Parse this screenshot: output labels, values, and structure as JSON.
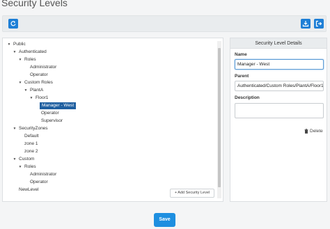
{
  "page": {
    "title": "Security Levels"
  },
  "toolbar": {
    "refresh_icon": "refresh-icon",
    "export_icon": "download-icon",
    "logout_icon": "logout-icon",
    "accent": "#1e7fd6"
  },
  "tree": {
    "nodes": [
      {
        "label": "Public",
        "toggle": "▼",
        "level": 0
      },
      {
        "label": "Authenticated",
        "toggle": "▼",
        "level": 1
      },
      {
        "label": "Roles",
        "toggle": "▼",
        "level": 2
      },
      {
        "label": "Administrator",
        "toggle": "",
        "level": 3
      },
      {
        "label": "Operator",
        "toggle": "",
        "level": 3
      },
      {
        "label": "Custom Roles",
        "toggle": "▼",
        "level": 2
      },
      {
        "label": "PlantA",
        "toggle": "▼",
        "level": 3
      },
      {
        "label": "Floor1",
        "toggle": "▼",
        "level": 4
      },
      {
        "label": "Manager - West",
        "toggle": "",
        "level": 5,
        "selected": true
      },
      {
        "label": "Operator",
        "toggle": "",
        "level": 5
      },
      {
        "label": "Supervisor",
        "toggle": "",
        "level": 5
      },
      {
        "label": "SecurityZones",
        "toggle": "▼",
        "level": 1
      },
      {
        "label": "Default",
        "toggle": "",
        "level": 2
      },
      {
        "label": "zone 1",
        "toggle": "",
        "level": 2
      },
      {
        "label": "zone 2",
        "toggle": "",
        "level": 2
      },
      {
        "label": "Custom",
        "toggle": "▼",
        "level": 1
      },
      {
        "label": "Roles",
        "toggle": "▼",
        "level": 2
      },
      {
        "label": "Administrator",
        "toggle": "",
        "level": 3
      },
      {
        "label": "Operator",
        "toggle": "",
        "level": 3
      },
      {
        "label": "NewLevel",
        "toggle": "",
        "level": 1
      }
    ],
    "selected_color": "#1f5fa0",
    "add_label": "+ Add Security Level"
  },
  "details": {
    "header": "Security Level Details",
    "name_label": "Name",
    "name_value": "Manager - West",
    "parent_label": "Parent",
    "parent_value": "Authenticated/Custom Roles/PlantA/Floor1",
    "description_label": "Description",
    "description_value": "",
    "delete_label": "Delete"
  },
  "footer": {
    "save_label": "Save",
    "save_color": "#1e8fe0"
  }
}
